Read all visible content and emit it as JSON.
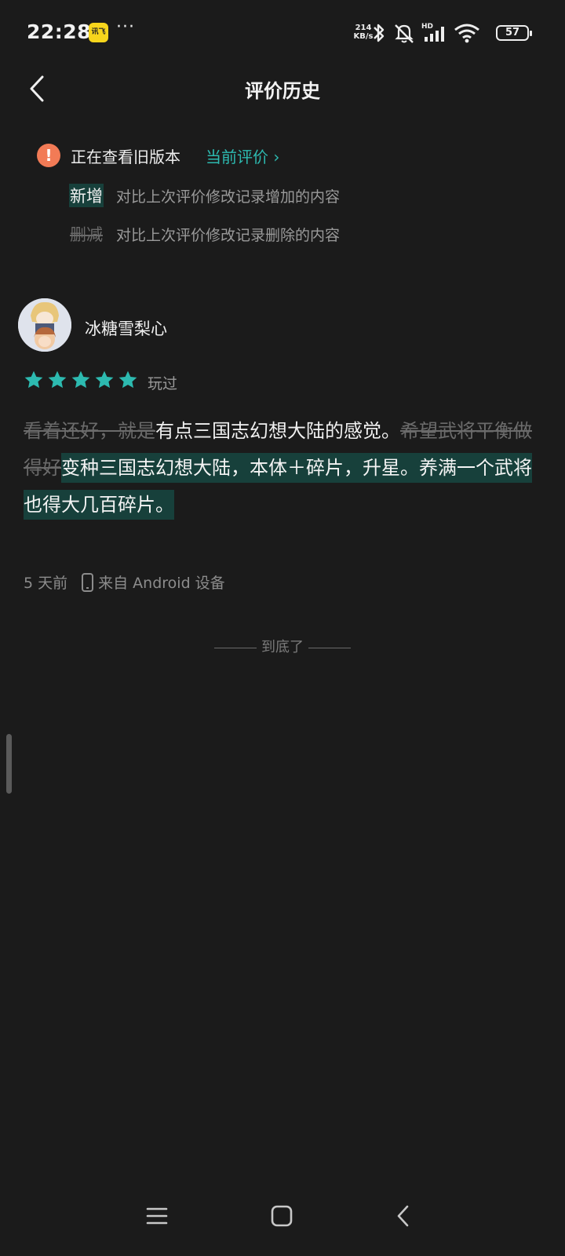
{
  "status_bar": {
    "time": "22:28",
    "app_badge": "讯飞",
    "more": "···",
    "net_speed_value": "214",
    "net_speed_unit": "KB/s",
    "network_label": "HD",
    "battery": "57",
    "icons": [
      "bluetooth-icon",
      "mute-icon",
      "signal-icon",
      "wifi-icon",
      "battery-icon"
    ]
  },
  "header": {
    "title": "评价历史",
    "back_icon": "chevron-left-icon"
  },
  "notice": {
    "icon": "warning-icon",
    "text": "正在查看旧版本",
    "current_link": "当前评价 ›",
    "legend": [
      {
        "tag": "新增",
        "desc": "对比上次评价修改记录增加的内容"
      },
      {
        "tag": "删减",
        "desc": "对比上次评价修改记录删除的内容"
      }
    ]
  },
  "review": {
    "username": "冰糖雪梨心",
    "rating": 5,
    "rating_max": 5,
    "status": "玩过",
    "accent_color": "#2dbab0",
    "content_segments": [
      {
        "type": "removed",
        "text": "看着还好，就是"
      },
      {
        "type": "normal",
        "text": "有点三国志幻想大陆的感觉。"
      },
      {
        "type": "removed",
        "text": "希望武将平衡做得好"
      },
      {
        "type": "added",
        "text": "变种三国志幻想大陆，本体＋碎片，升星。养满一个武将也得大几百碎片。"
      }
    ],
    "time": "5 天前",
    "source": "来自 Android 设备"
  },
  "footer": {
    "end_text": "到底了"
  },
  "nav_bar": {
    "icons": [
      "menu-icon",
      "home-icon",
      "back-icon"
    ]
  }
}
